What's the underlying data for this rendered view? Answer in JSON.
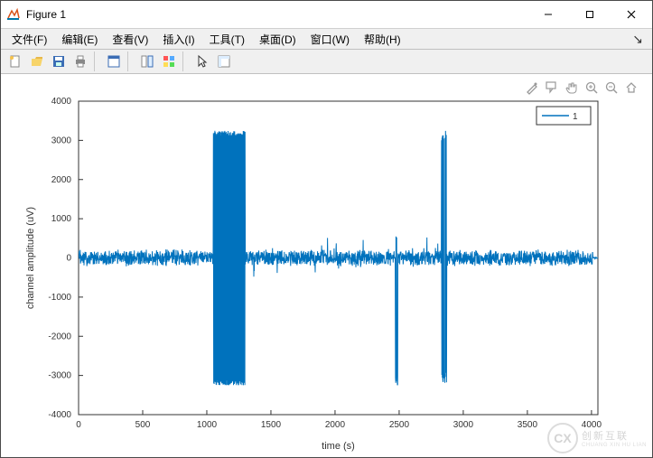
{
  "window": {
    "title": "Figure 1"
  },
  "menu": {
    "items": [
      {
        "label": "文件(F)"
      },
      {
        "label": "编辑(E)"
      },
      {
        "label": "查看(V)"
      },
      {
        "label": "插入(I)"
      },
      {
        "label": "工具(T)"
      },
      {
        "label": "桌面(D)"
      },
      {
        "label": "窗口(W)"
      },
      {
        "label": "帮助(H)"
      }
    ]
  },
  "toolbar": {
    "buttons": [
      {
        "name": "new-figure-icon"
      },
      {
        "name": "open-icon"
      },
      {
        "name": "save-icon"
      },
      {
        "name": "print-icon"
      },
      {
        "sep": true
      },
      {
        "name": "data-cursor-icon"
      },
      {
        "sep": true
      },
      {
        "name": "link-plot-icon"
      },
      {
        "name": "insert-colorbar-icon"
      },
      {
        "sep": true
      },
      {
        "name": "pointer-icon"
      },
      {
        "name": "plot-tools-icon"
      }
    ]
  },
  "axes_toolbar": {
    "buttons": [
      {
        "name": "brush-icon"
      },
      {
        "name": "data-tips-icon"
      },
      {
        "name": "pan-icon"
      },
      {
        "name": "zoom-in-icon"
      },
      {
        "name": "zoom-out-icon"
      },
      {
        "name": "home-icon"
      }
    ]
  },
  "chart_data": {
    "type": "line",
    "title": "",
    "xlabel": "time (s)",
    "ylabel": "channel amplitude (uV)",
    "xlim": [
      0,
      4050
    ],
    "ylim": [
      -4000,
      4000
    ],
    "xticks": [
      0,
      500,
      1000,
      1500,
      2000,
      2500,
      3000,
      3500,
      4000
    ],
    "yticks": [
      -4000,
      -3000,
      -2000,
      -1000,
      0,
      1000,
      2000,
      3000,
      4000
    ],
    "legend": {
      "position": "northeast",
      "entries": [
        "1"
      ]
    },
    "series": [
      {
        "name": "1",
        "color": "#0072bd",
        "description": "Single-channel signal sampled over ~4050 s. Baseline noise around 0 with amplitude roughly ±200 uV. Large saturating oscillation block between ~1050 s and ~1300 s reaching ±3250 uV. Two narrow large spikes: one around 2480 s reaching about -3250 uV (and +500 uV), and one around 2850 s reaching ±3250 uV. Moderate spikes (~±500 uV) scattered between 1400-2900 s. Signal quiet (near 0) after ~4010 s.",
        "baseline_amplitude_uV": 200,
        "events": [
          {
            "t_start": 1050,
            "t_end": 1300,
            "min": -3250,
            "max": 3250,
            "kind": "saturating-block"
          },
          {
            "t_start": 2470,
            "t_end": 2490,
            "min": -3250,
            "max": 550,
            "kind": "spike"
          },
          {
            "t_start": 2830,
            "t_end": 2870,
            "min": -3250,
            "max": 3250,
            "kind": "spike"
          }
        ]
      }
    ]
  },
  "watermark": {
    "logo_text": "CX",
    "line1": "创新互联",
    "line2": "CHUANG XIN HU LIAN"
  }
}
